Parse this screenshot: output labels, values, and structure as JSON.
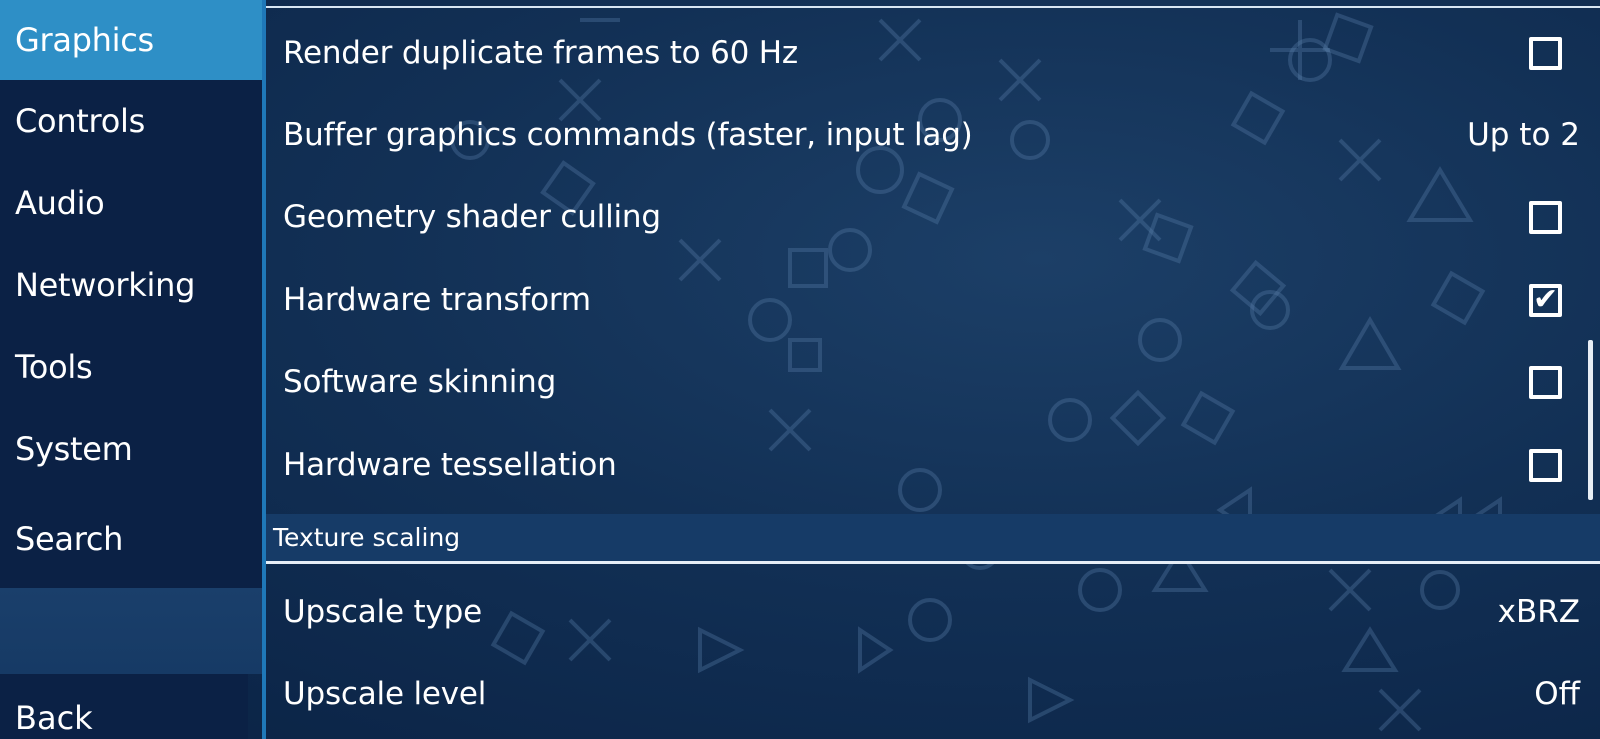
{
  "sidebar": {
    "items": [
      {
        "label": "Graphics",
        "selected": true
      },
      {
        "label": "Controls",
        "selected": false
      },
      {
        "label": "Audio",
        "selected": false
      },
      {
        "label": "Networking",
        "selected": false
      },
      {
        "label": "Tools",
        "selected": false
      },
      {
        "label": "System",
        "selected": false
      },
      {
        "label": "Search",
        "selected": false
      }
    ],
    "back_label": "Back"
  },
  "settings": {
    "rows": [
      {
        "label": "Render duplicate frames to 60 Hz",
        "type": "checkbox",
        "checked": false
      },
      {
        "label": "Buffer graphics commands (faster, input lag)",
        "type": "value",
        "value": "Up to 2"
      },
      {
        "label": "Geometry shader culling",
        "type": "checkbox",
        "checked": false
      },
      {
        "label": "Hardware transform",
        "type": "checkbox",
        "checked": true
      },
      {
        "label": "Software skinning",
        "type": "checkbox",
        "checked": false
      },
      {
        "label": "Hardware tessellation",
        "type": "checkbox",
        "checked": false
      }
    ],
    "section_header": "Texture scaling",
    "section_rows": [
      {
        "label": "Upscale type",
        "type": "value",
        "value": "xBRZ"
      },
      {
        "label": "Upscale level",
        "type": "value",
        "value": "Off"
      }
    ]
  },
  "checkmark_glyph": "✔",
  "colors": {
    "background": "#123055",
    "sidebar": "#0b2145",
    "selected": "#2e8fc6",
    "divider": "#1f78b8"
  },
  "icons": [
    "cross-icon",
    "circle-icon",
    "square-icon",
    "triangle-icon",
    "checkmark-icon"
  ]
}
